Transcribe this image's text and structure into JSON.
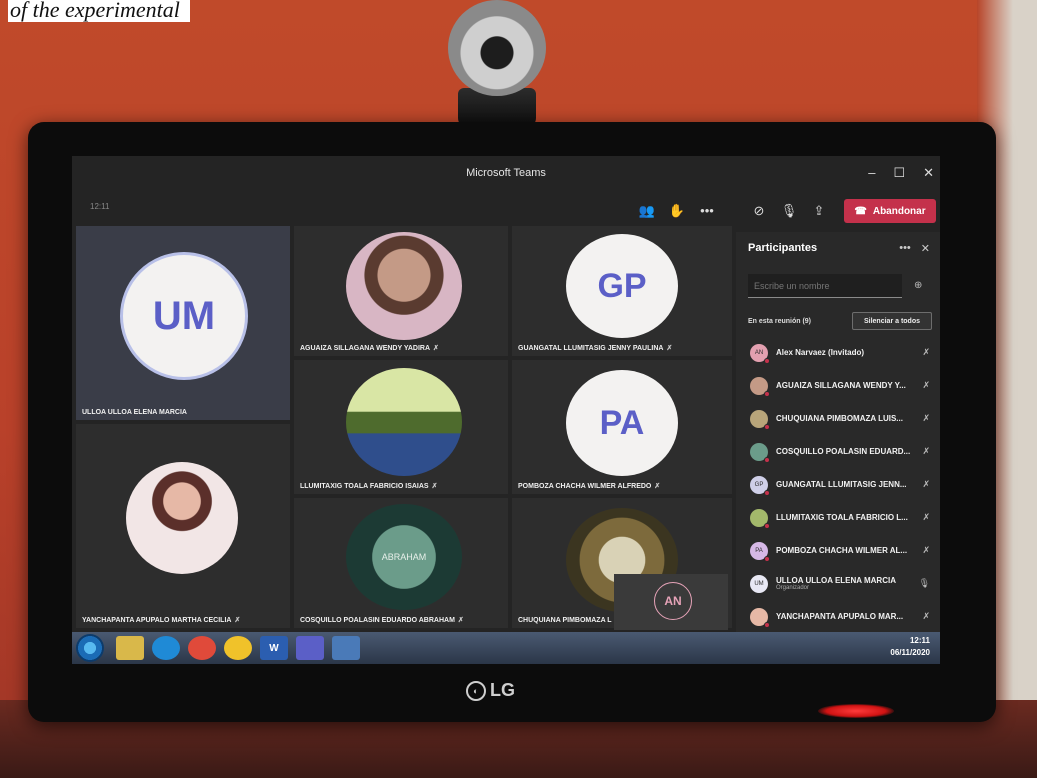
{
  "caption": "of the experimental",
  "monitor_brand": "LG",
  "window": {
    "title": "Microsoft Teams",
    "controls": [
      "–",
      "☐",
      "✕"
    ]
  },
  "toolbar": {
    "elapsed": "12:11",
    "leave_label": "Abandonar"
  },
  "tiles": [
    {
      "initials": "UM",
      "name": "ULLOA ULLOA ELENA MARCIA"
    },
    {
      "initials": "",
      "name": "AGUAIZA SILLAGANA WENDY YADIRA"
    },
    {
      "initials": "GP",
      "name": "GUANGATAL LLUMITASIG JENNY PAULINA"
    },
    {
      "initials": "",
      "name": "LLUMITAXIG TOALA FABRICIO ISAIAS"
    },
    {
      "initials": "PA",
      "name": "POMBOZA CHACHA WILMER ALFREDO"
    },
    {
      "initials": "",
      "name": "YANCHAPANTA APUPALO MARTHA CECILIA"
    },
    {
      "initials": "",
      "name": "COSQUILLO POALASIN EDUARDO ABRAHAM",
      "photo_text": "ABRAHAM"
    },
    {
      "initials": "",
      "name": "CHUQUIANA PIMBOMAZA L"
    }
  ],
  "selfview": {
    "initials": "AN"
  },
  "participants": {
    "title": "Participantes",
    "search_placeholder": "Escribe un nombre",
    "meeting_count": "En esta reunión (9)",
    "mute_all_label": "Silenciar a todos",
    "list": [
      {
        "initials": "AN",
        "name": "Alex Narvaez (Invitado)",
        "role": ""
      },
      {
        "initials": "",
        "name": "AGUAIZA SILLAGANA WENDY Y...",
        "role": ""
      },
      {
        "initials": "",
        "name": "CHUQUIANA PIMBOMAZA LUIS...",
        "role": ""
      },
      {
        "initials": "",
        "name": "COSQUILLO POALASIN EDUARD...",
        "role": ""
      },
      {
        "initials": "GP",
        "name": "GUANGATAL LLUMITASIG JENN...",
        "role": ""
      },
      {
        "initials": "",
        "name": "LLUMITAXIG TOALA FABRICIO L...",
        "role": ""
      },
      {
        "initials": "PA",
        "name": "POMBOZA CHACHA WILMER AL...",
        "role": ""
      },
      {
        "initials": "UM",
        "name": "ULLOA ULLOA ELENA MARCIA",
        "role": "Organizador"
      },
      {
        "initials": "",
        "name": "YANCHAPANTA APUPALO MAR...",
        "role": ""
      }
    ]
  },
  "taskbar": {
    "time": "12:11",
    "date": "06/11/2020",
    "word_label": "W"
  }
}
